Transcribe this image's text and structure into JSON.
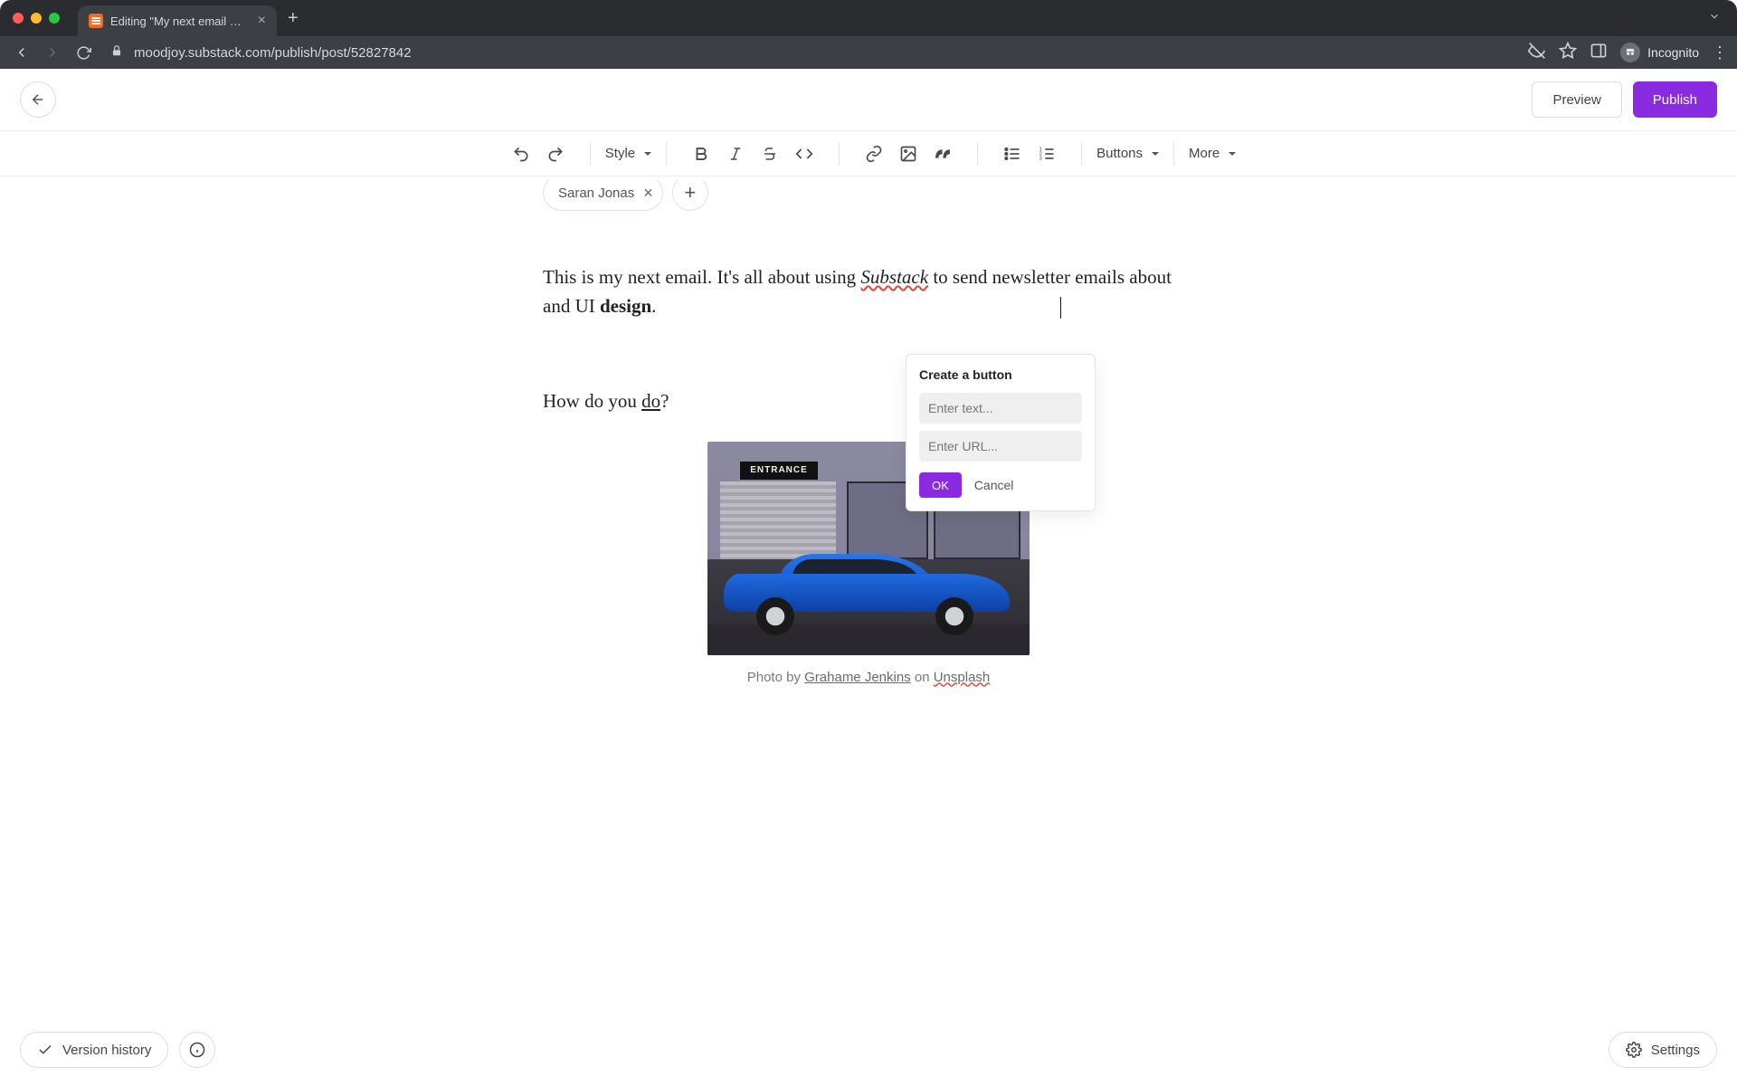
{
  "browser": {
    "tab_title": "Editing \"My next email messag",
    "url": "moodjoy.substack.com/publish/post/52827842",
    "incognito_label": "Incognito"
  },
  "header": {
    "preview": "Preview",
    "publish": "Publish"
  },
  "toolbar": {
    "style": "Style",
    "buttons": "Buttons",
    "more": "More"
  },
  "author": {
    "name": "Saran Jonas"
  },
  "content": {
    "p1_a": "This is my next email. It's all about using ",
    "p1_substack": "Substack",
    "p1_b": " to send newsletter emails about and UI ",
    "p1_design": "design",
    "p1_end": ".",
    "p2_a": "How do you ",
    "p2_do": "do",
    "p2_b": "?",
    "entrance_sign": "ENTRANCE",
    "caption_pre": "Photo by ",
    "caption_author": "Grahame Jenkins",
    "caption_on": " on ",
    "caption_source": "Unsplash"
  },
  "popover": {
    "title": "Create a button",
    "text_placeholder": "Enter text...",
    "url_placeholder": "Enter URL...",
    "ok": "OK",
    "cancel": "Cancel"
  },
  "bottom": {
    "version_history": "Version history",
    "settings": "Settings"
  }
}
